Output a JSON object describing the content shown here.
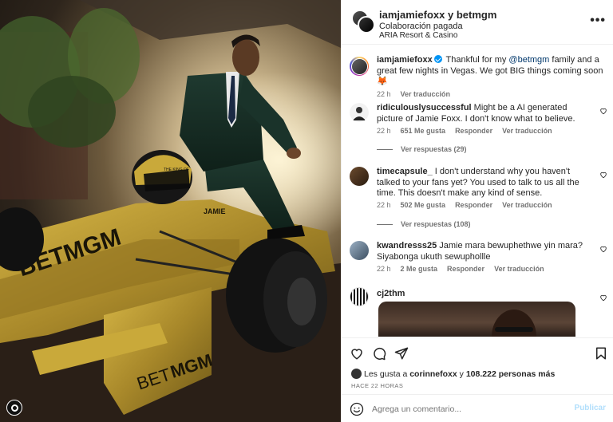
{
  "post": {
    "owner_line": "iamjamiefoxx y betmgm",
    "sponsored": "Colaboración pagada",
    "location": "ARIA Resort & Casino",
    "more_label": "•••"
  },
  "image": {
    "wordmark_nose": "BETMGM",
    "wordmark_wing_left": "BET",
    "wordmark_wing_right": "MGM",
    "helmet_text": "THE KING OF",
    "car_name": "JAMIE"
  },
  "caption": {
    "user": "iamjamiefoxx",
    "text_before_mention": " Thankful for my ",
    "mention": "@betmgm",
    "text_after_mention": " family and a great few nights in Vegas. We got BIG things coming soon 🦊",
    "time": "22 h",
    "translate": "Ver traducción"
  },
  "comments": [
    {
      "user": "ridiculouslysuccessful",
      "text": " Might be a AI generated picture of Jamie Foxx. I don't know what to believe.",
      "time": "22 h",
      "likes": "651 Me gusta",
      "reply": "Responder",
      "translate": "Ver traducción",
      "replies": "Ver respuestas (29)"
    },
    {
      "user": "timecapsule_",
      "text": " I don't understand why you haven't talked to your fans yet? You used to talk to us all the time. This doesn't make any kind of sense.",
      "time": "22 h",
      "likes": "502 Me gusta",
      "reply": "Responder",
      "translate": "Ver traducción",
      "replies": "Ver respuestas (108)"
    },
    {
      "user": "kwandresss25",
      "text": " Jamie mara bewuphethwe yin mara? Siyabonga ukuth sewuphollle",
      "time": "22 h",
      "likes": "2 Me gusta",
      "reply": "Responder",
      "translate": "Ver traducción"
    },
    {
      "user": "cj2thm",
      "text": ""
    }
  ],
  "footer": {
    "likes_prefix": "Les gusta a ",
    "likes_user": "corinnefoxx",
    "likes_middle": " y ",
    "likes_count": "108.222 personas más",
    "time": "HACE 22 HORAS",
    "comment_placeholder": "Agrega un comentario...",
    "publish": "Publicar"
  },
  "colors": {
    "accent_blue": "#0095f6",
    "publish_disabled": "#b2dffc",
    "mention": "#00376b",
    "car_gold": "#b39228"
  }
}
